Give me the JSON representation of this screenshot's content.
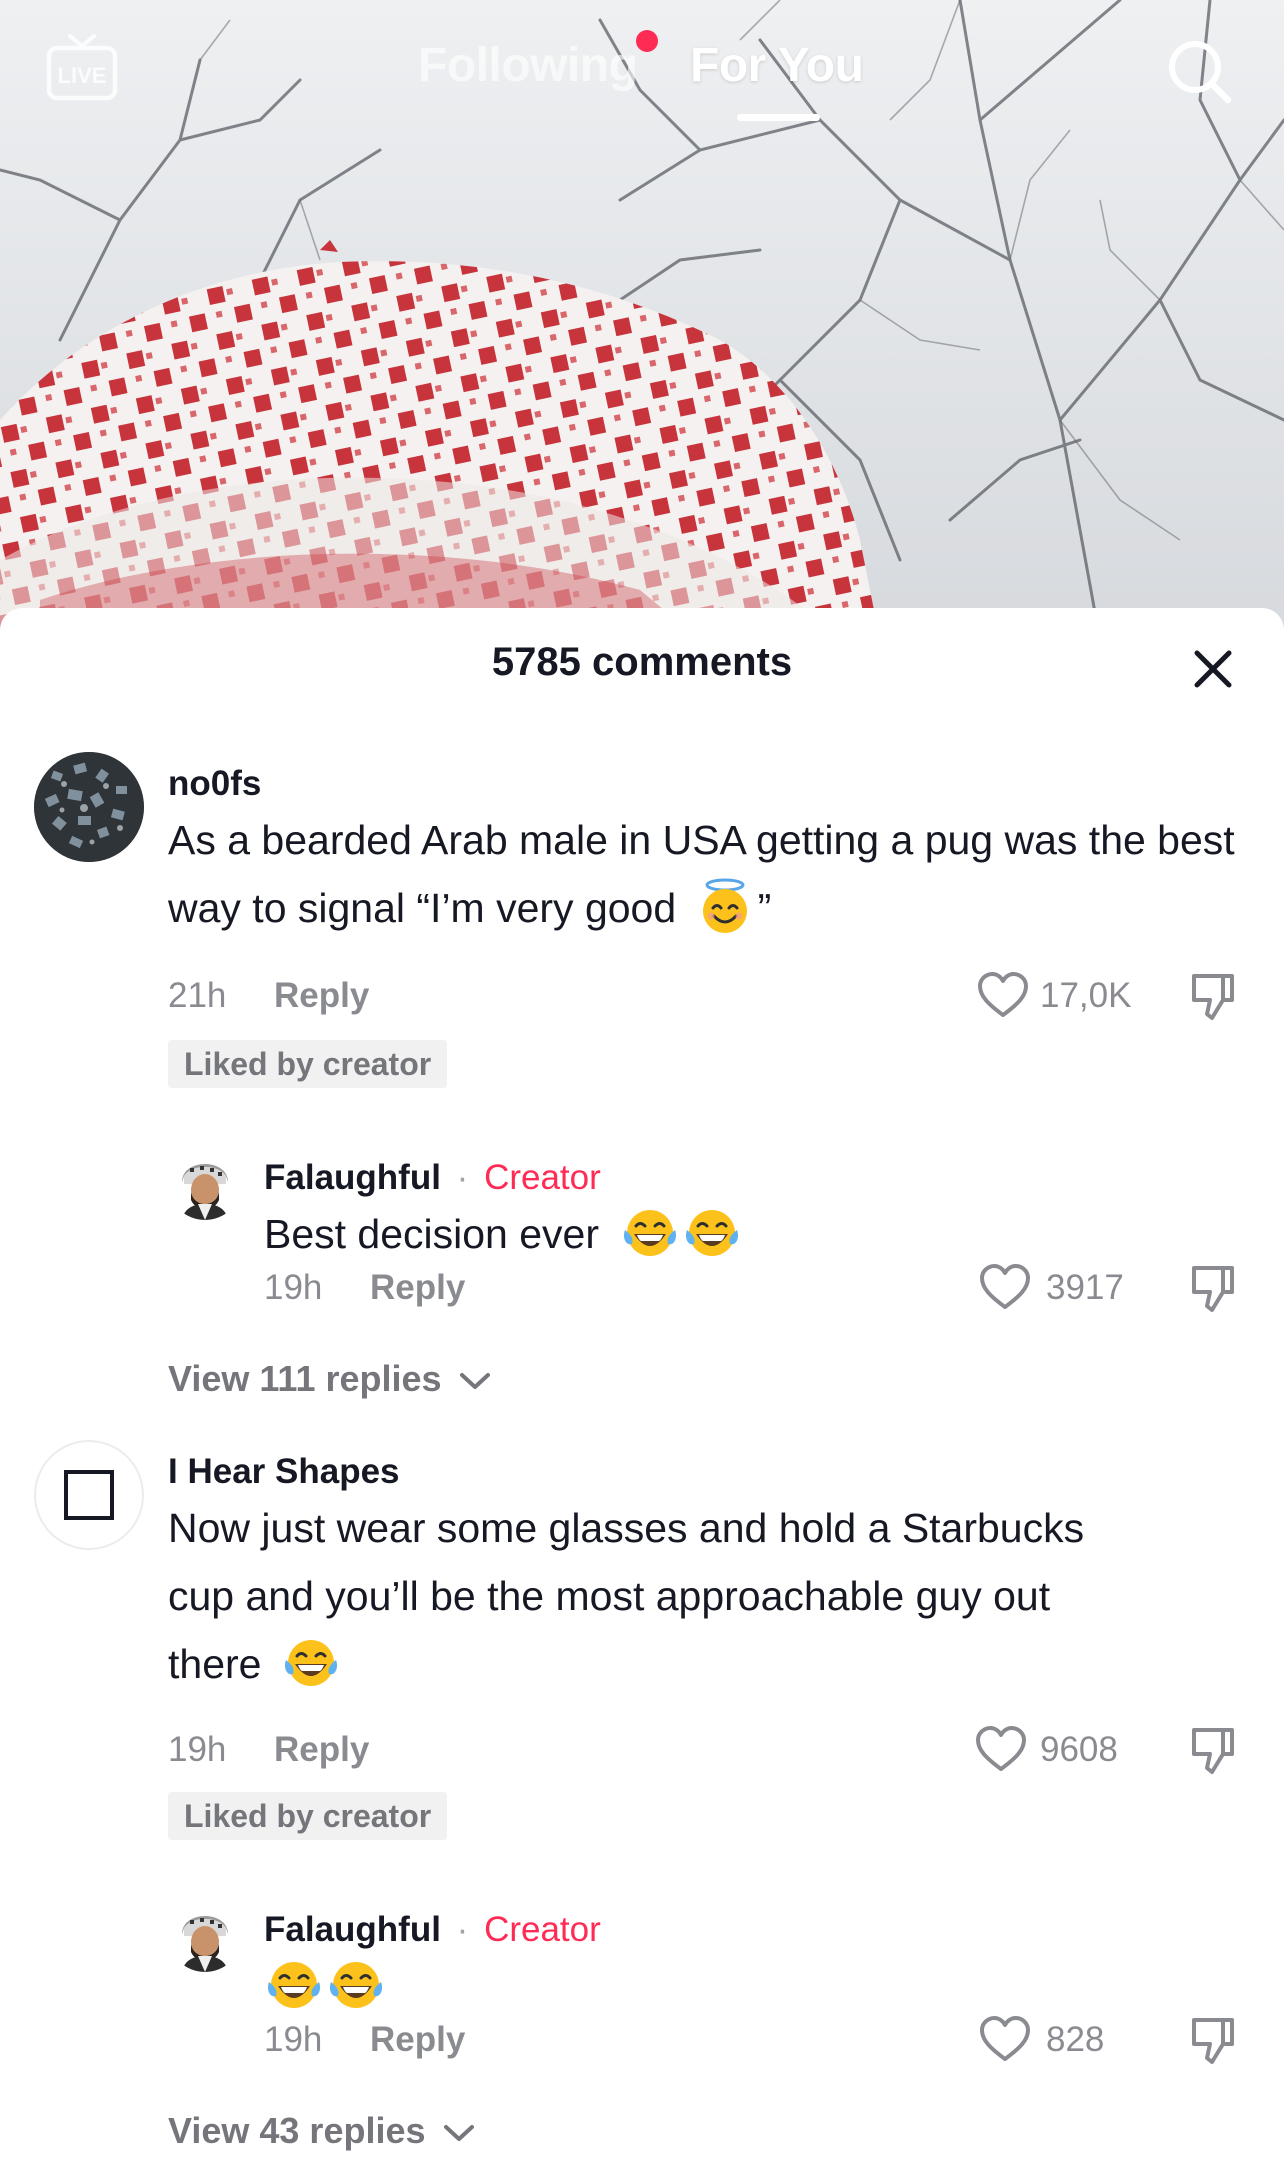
{
  "topnav": {
    "live_label": "LIVE",
    "following_label": "Following",
    "foryou_label": "For You"
  },
  "comments_sheet": {
    "title": "5785 comments",
    "comments": [
      {
        "username": "no0fs",
        "text": "As a bearded Arab male in USA getting a pug was the best way to signal “I’m very good",
        "text_emoji": "smiling-face-with-halo",
        "text_end": "”",
        "time": "21h",
        "reply_label": "Reply",
        "likes": "17,0K",
        "liked_by_creator": "Liked by creator",
        "reply": {
          "username": "Falaughful",
          "separator": "·",
          "tag": "Creator",
          "text": "Best decision ever",
          "emoji": "face-with-tears-of-joy",
          "time": "19h",
          "reply_label": "Reply",
          "likes": "3917"
        },
        "view_replies": "View 111 replies"
      },
      {
        "username": "I Hear Shapes",
        "text_line1": "Now just wear some glasses and hold a Starbucks",
        "text_line2": "cup and you’ll be the most approachable guy out",
        "text_line3": "there",
        "emoji": "face-with-tears-of-joy",
        "time": "19h",
        "reply_label": "Reply",
        "likes": "9608",
        "liked_by_creator": "Liked by creator",
        "reply": {
          "username": "Falaughful",
          "separator": "·",
          "tag": "Creator",
          "emoji": "face-with-tears-of-joy",
          "time": "19h",
          "reply_label": "Reply",
          "likes": "828"
        },
        "view_replies": "View 43 replies"
      }
    ]
  },
  "colors": {
    "accent": "#fe2c55",
    "text_primary": "#161823",
    "text_secondary": "#8a8b91",
    "badge_bg": "#f1f1f2",
    "keffiyeh_red": "#c8343c"
  }
}
